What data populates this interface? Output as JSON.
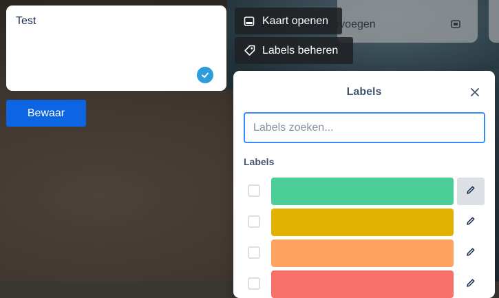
{
  "card": {
    "text": "Test",
    "save_label": "Bewaar"
  },
  "quick_actions": {
    "open_card": "Kaart openen",
    "manage_labels": "Labels beheren"
  },
  "background": {
    "add_card_text": "Een kaart toevoegen"
  },
  "popover": {
    "title": "Labels",
    "search_placeholder": "Labels zoeken...",
    "section_title": "Labels",
    "labels": [
      {
        "color": "#4bce97",
        "checked": false
      },
      {
        "color": "#e2b203",
        "checked": false
      },
      {
        "color": "#fea362",
        "checked": false
      },
      {
        "color": "#f87168",
        "checked": false
      }
    ]
  },
  "colors": {
    "primary": "#0c66e4",
    "focus": "#388bff",
    "check": "#2d9cdb"
  }
}
